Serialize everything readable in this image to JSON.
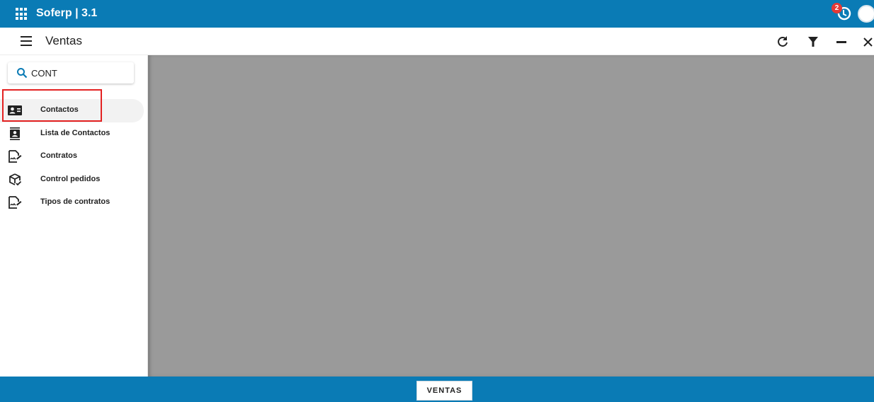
{
  "app": {
    "title": "Soferp | 3.1",
    "notification_count": "2"
  },
  "toolbar": {
    "module_title": "Ventas",
    "icons": [
      "refresh-icon",
      "filter-icon",
      "minimize-icon",
      "close-icon"
    ]
  },
  "search": {
    "value": "CONT"
  },
  "nav": {
    "items": [
      {
        "label": "Contactos",
        "icon": "contact-card-icon",
        "active": true
      },
      {
        "label": "Lista de Contactos",
        "icon": "contact-list-icon"
      },
      {
        "label": "Contratos",
        "icon": "contract-icon"
      },
      {
        "label": "Control pedidos",
        "icon": "package-check-icon"
      },
      {
        "label": "Tipos de contratos",
        "icon": "contract-icon"
      }
    ]
  },
  "footer": {
    "tab_label": "VENTAS"
  },
  "colors": {
    "primary": "#0a7bb5",
    "content_bg": "#9a9a9a",
    "badge": "#e53935",
    "highlight": "#e32222"
  }
}
